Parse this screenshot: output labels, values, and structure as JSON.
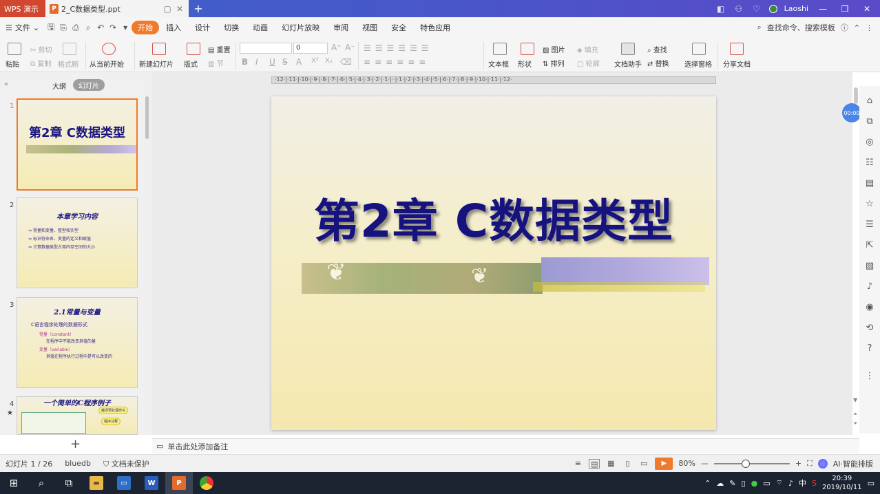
{
  "titlebar": {
    "app_name": "WPS 演示",
    "doc_name": "2_C数据类型.ppt",
    "user_name": "Laoshi",
    "new_tab": "+"
  },
  "menu": {
    "file_label": "文件",
    "tabs": [
      "开始",
      "插入",
      "设计",
      "切换",
      "动画",
      "幻灯片放映",
      "审阅",
      "视图",
      "安全",
      "特色应用"
    ],
    "active_tab": "开始",
    "search_placeholder": "查找命令、搜索模板"
  },
  "ribbon": {
    "paste": "粘贴",
    "cut": "剪切",
    "copy": "复制",
    "format_painter": "格式刷",
    "from_current": "从当前开始",
    "new_slide": "新建幻灯片",
    "layout": "版式",
    "reset": "重置",
    "section": "节",
    "font_size": "0",
    "text_box": "文本框",
    "shape": "形状",
    "picture": "图片",
    "arrange": "排列",
    "fill": "填充",
    "outline": "轮廓",
    "doc_helper": "文档助手",
    "find": "查找",
    "replace": "替换",
    "selection_pane": "选择窗格",
    "share_doc": "分享文档"
  },
  "left_panel": {
    "tab_outline": "大纲",
    "tab_slides": "幻灯片",
    "slides": [
      {
        "num": "1",
        "title": "第2章 C数据类型"
      },
      {
        "num": "2",
        "title": "本章学习内容",
        "lines": [
          "常量和变量、整型和实型",
          "标识符命名、变量的定义和赋值",
          "计算数据类型占用内存空间的大小"
        ]
      },
      {
        "num": "3",
        "title": "2.1常量与变量",
        "lines": [
          "C语言程序处理的数据形式",
          "常量（constant）",
          "在程序中不能改变其值的量",
          "变量（variable）",
          "其值在程序执行过程中是可以改变的"
        ]
      },
      {
        "num": "4",
        "title": "一个简单的C程序例子",
        "lines": [
          "编译预处理命令",
          "程序注释"
        ]
      }
    ]
  },
  "slide": {
    "title": "第2章 C数据类型"
  },
  "timer": "00:00",
  "notes_placeholder": "单击此处添加备注",
  "status": {
    "slide_index": "幻灯片 1 / 26",
    "theme": "bluedb",
    "protection": "文档未保护",
    "zoom": "80%",
    "ai_layout": "AI·智能排版"
  },
  "taskbar": {
    "time": "20:39",
    "date": "2019/10/11",
    "ime": "中"
  }
}
